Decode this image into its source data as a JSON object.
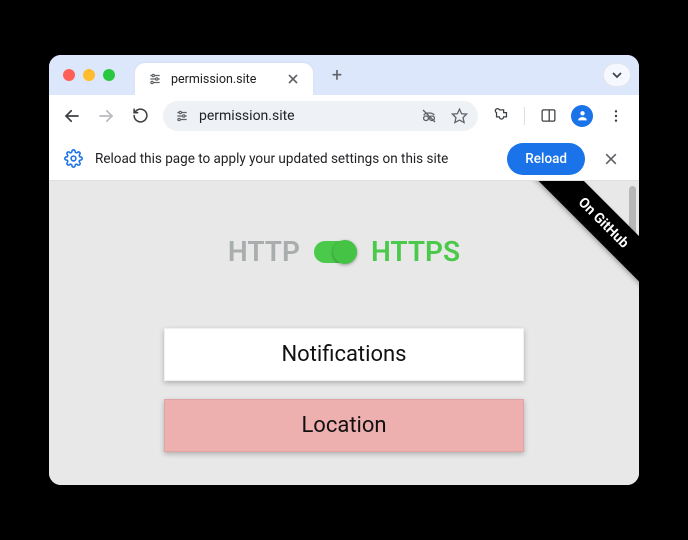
{
  "tab": {
    "title": "permission.site"
  },
  "omnibox": {
    "url_text": "permission.site"
  },
  "infobar": {
    "message": "Reload this page to apply your updated settings on this site",
    "reload_label": "Reload"
  },
  "ribbon": {
    "label": "On GitHub"
  },
  "protocol_toggle": {
    "off_label": "HTTP",
    "on_label": "HTTPS",
    "state": "on"
  },
  "permission_buttons": [
    {
      "id": "notifications",
      "label": "Notifications",
      "status": "default"
    },
    {
      "id": "location",
      "label": "Location",
      "status": "denied"
    }
  ],
  "colors": {
    "accent": "#1a73e8",
    "https_green": "#4ac94a",
    "denied_pink": "#eeafaf"
  }
}
